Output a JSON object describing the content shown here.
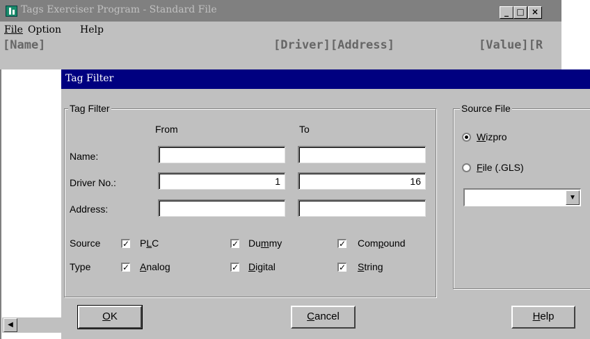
{
  "main_window": {
    "title": "Tags Exerciser Program - Standard File",
    "menu": [
      "File",
      "Option",
      "Help"
    ],
    "columns": {
      "name": "[Name]",
      "driver_address": "[Driver][Address]",
      "value": "[Value][R"
    },
    "caption_buttons": {
      "minimize": "_",
      "maximize": "□",
      "close": "×"
    },
    "scroll_left": "◀"
  },
  "dialog": {
    "title": "Tag Filter",
    "filter_group": {
      "label": "Tag Filter",
      "from_header": "From",
      "to_header": "To",
      "name_label": "Name:",
      "name_from": "",
      "name_to": "",
      "driver_label": "Driver No.:",
      "driver_from": "1",
      "driver_to": "16",
      "address_label": "Address:",
      "address_from": "",
      "address_to": "",
      "source_label": "Source",
      "type_label": "Type",
      "checkboxes": {
        "plc": {
          "pre": "P",
          "u": "L",
          "post": "C",
          "checked": true
        },
        "dummy": {
          "pre": "Du",
          "u": "m",
          "post": "my",
          "checked": true
        },
        "compound": {
          "pre": "Com",
          "u": "p",
          "post": "ound",
          "checked": true
        },
        "analog": {
          "pre": "",
          "u": "A",
          "post": "nalog",
          "checked": true
        },
        "digital": {
          "pre": "",
          "u": "D",
          "post": "igital",
          "checked": true
        },
        "string": {
          "pre": "",
          "u": "S",
          "post": "tring",
          "checked": true
        }
      },
      "check_mark": "✓"
    },
    "source_group": {
      "label": "Source File",
      "wizpro": {
        "pre": "",
        "u": "W",
        "post": "izpro",
        "selected": true
      },
      "file": {
        "pre": "",
        "u": "F",
        "post": "ile (.GLS)",
        "selected": false
      },
      "combo_value": "",
      "combo_arrow": "▼"
    },
    "buttons": {
      "ok": {
        "pre": "",
        "u": "O",
        "post": "K"
      },
      "cancel": {
        "pre": "",
        "u": "C",
        "post": "ancel"
      },
      "help": {
        "pre": "",
        "u": "H",
        "post": "elp"
      }
    }
  },
  "colors": {
    "title_active": "#000080",
    "title_inactive": "#808080",
    "face": "#c0c0c0"
  }
}
